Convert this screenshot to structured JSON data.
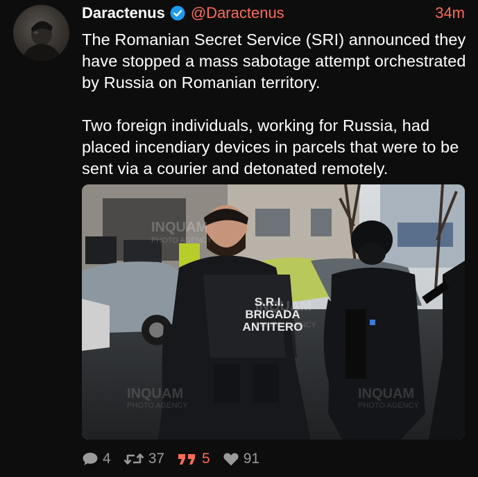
{
  "tweet": {
    "display_name": "Daractenus",
    "handle": "@Daractenus",
    "timestamp": "34m",
    "verified": true,
    "paragraphs": [
      "The Romanian Secret Service (SRI) announced they have stopped a mass sabotage attempt orchestrated by Russia on Romanian territory.",
      "Two foreign individuals, working for Russia, had placed incendiary devices in parcels that were to be sent via a courier and detonated remotely."
    ]
  },
  "media": {
    "vest_text_line1": "S.R.I.",
    "vest_text_line2": "BRIGADA",
    "vest_text_line3": "ANTITERO",
    "watermark": "INQUAM",
    "watermark_sub": "PHOTO AGENCY"
  },
  "actions": {
    "reply_count": "4",
    "retweet_count": "37",
    "quote_count": "5",
    "like_count": "91"
  },
  "colors": {
    "accent": "#ff6b57",
    "verified": "#1d9bf0",
    "background": "#0d0d0d",
    "muted": "#9a9a9a"
  },
  "icons": [
    "verified-badge-icon",
    "reply-icon",
    "retweet-icon",
    "quote-icon",
    "heart-icon"
  ]
}
